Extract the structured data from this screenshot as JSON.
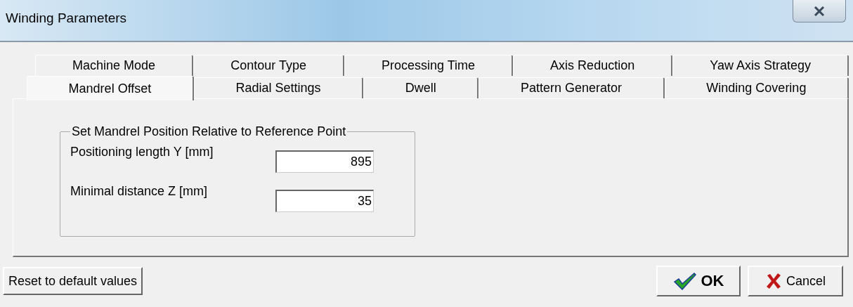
{
  "window": {
    "title": "Winding Parameters"
  },
  "tab_rows": [
    [
      {
        "label": "Machine Mode",
        "selected": false
      },
      {
        "label": "Contour Type",
        "selected": false
      },
      {
        "label": "Processing Time",
        "selected": false
      },
      {
        "label": "Axis Reduction",
        "selected": false
      },
      {
        "label": "Yaw Axis Strategy",
        "selected": false
      }
    ],
    [
      {
        "label": "Mandrel Offset",
        "selected": true
      },
      {
        "label": "Radial Settings",
        "selected": false
      },
      {
        "label": "Dwell",
        "selected": false
      },
      {
        "label": "Pattern Generator",
        "selected": false
      },
      {
        "label": "Winding Covering",
        "selected": false
      }
    ]
  ],
  "group": {
    "title": "Set Mandrel Position Relative to Reference Point",
    "fields": [
      {
        "label": "Positioning length Y [mm]",
        "value": "895"
      },
      {
        "label": "Minimal distance Z [mm]",
        "value": "35"
      }
    ]
  },
  "buttons": [
    {
      "kind": "reset",
      "label": "Reset to default values"
    },
    {
      "kind": "ok",
      "label": "OK"
    },
    {
      "kind": "cancel",
      "label": "Cancel"
    }
  ]
}
